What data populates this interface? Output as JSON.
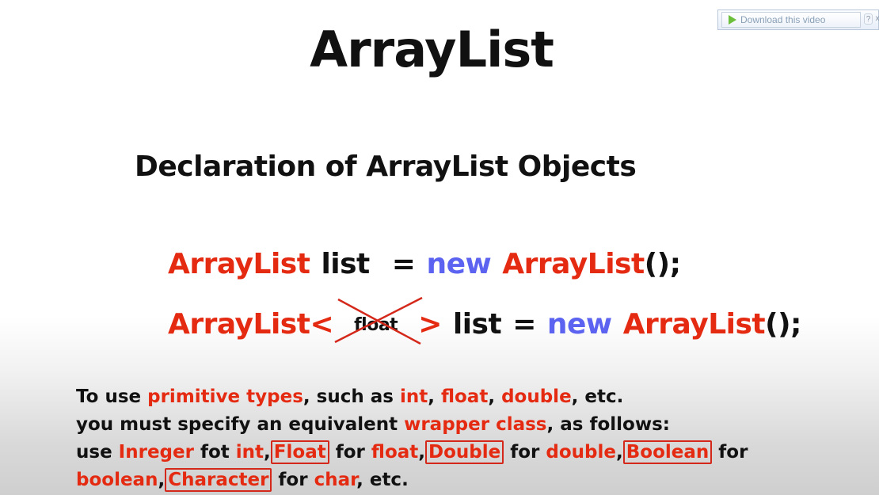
{
  "download_bar": {
    "label": "Download this video",
    "help": "?",
    "close": "x"
  },
  "slide": {
    "title": "ArrayList",
    "subtitle": "Declaration of ArrayList Objects",
    "code1": {
      "type": "ArrayList",
      "var": "list",
      "eq": "=",
      "new": "new",
      "ctor": "ArrayList",
      "end": "();"
    },
    "code2": {
      "type_open": "ArrayList<",
      "crossed": "float",
      "close": ">",
      "var": "list",
      "eq": "=",
      "new": "new",
      "ctor": "ArrayList",
      "end": "();"
    },
    "note": {
      "l1_a": "To use ",
      "l1_kw": "primitive types",
      "l1_b": ", such as ",
      "l1_int": "int",
      "l1_c": ", ",
      "l1_float": "float",
      "l1_d": ", ",
      "l1_double": "double",
      "l1_e": ", etc.",
      "l2_a": "you must specify an equivalent ",
      "l2_kw": "wrapper class",
      "l2_b": ", as follows:",
      "l3_a": "use ",
      "l3_integer": "Inreger",
      "l3_b": " fot ",
      "l3_int": "int",
      "l3_c": ",",
      "l3_Float": "Float",
      "l3_d": " for ",
      "l3_float": "float",
      "l3_e": ",",
      "l3_Double": "Double",
      "l3_f": " for ",
      "l3_double": "double",
      "l3_g": ",",
      "l3_Boolean": "Boolean",
      "l3_h": " for",
      "l4_boolean": "boolean",
      "l4_a": ",",
      "l4_Character": "Character",
      "l4_b": " for ",
      "l4_char": "char",
      "l4_c": ", etc."
    }
  },
  "colors": {
    "keyword_red": "#e52a12",
    "new_blue": "#5b63f0",
    "text_dark": "#111111"
  }
}
